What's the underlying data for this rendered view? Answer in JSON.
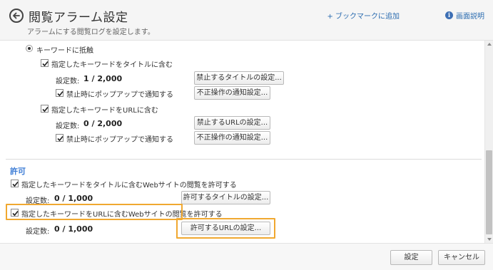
{
  "header": {
    "title": "閲覧アラーム設定",
    "subtitle": "アラームにする閲覧ログを設定します。",
    "bookmark_link": "+ ブックマークに追加",
    "help_link": "画面説明"
  },
  "violation": {
    "radio_label": "キーワードに抵触",
    "title_check_label": "指定したキーワードをタイトルに含む",
    "title_count_label": "設定数:",
    "title_count_value": "1 / 2,000",
    "title_forbid_button": "禁止するタイトルの設定...",
    "title_popup_label": "禁止時にポップアップで通知する",
    "title_notify_button": "不正操作の通知設定...",
    "url_check_label": "指定したキーワードをURLに含む",
    "url_count_label": "設定数:",
    "url_count_value": "0 / 2,000",
    "url_forbid_button": "禁止するURLの設定...",
    "url_popup_label": "禁止時にポップアップで通知する",
    "url_notify_button": "不正操作の通知設定..."
  },
  "allow": {
    "section_title": "許可",
    "title_check_label": "指定したキーワードをタイトルに含むWebサイトの閲覧を許可する",
    "title_count_label": "設定数:",
    "title_count_value": "0 / 1,000",
    "title_allow_button": "許可するタイトルの設定...",
    "url_check_label": "指定したキーワードをURLに含むWebサイトの閲覧を許可する",
    "url_count_label": "設定数:",
    "url_count_value": "0 / 1,000",
    "url_allow_button": "許可するURLの設定..."
  },
  "footer": {
    "ok_button": "設定",
    "cancel_button": "キャンセル"
  },
  "colors": {
    "accent": "#3a7bd5",
    "highlight": "#f0a830",
    "link": "#2b6cb0"
  }
}
